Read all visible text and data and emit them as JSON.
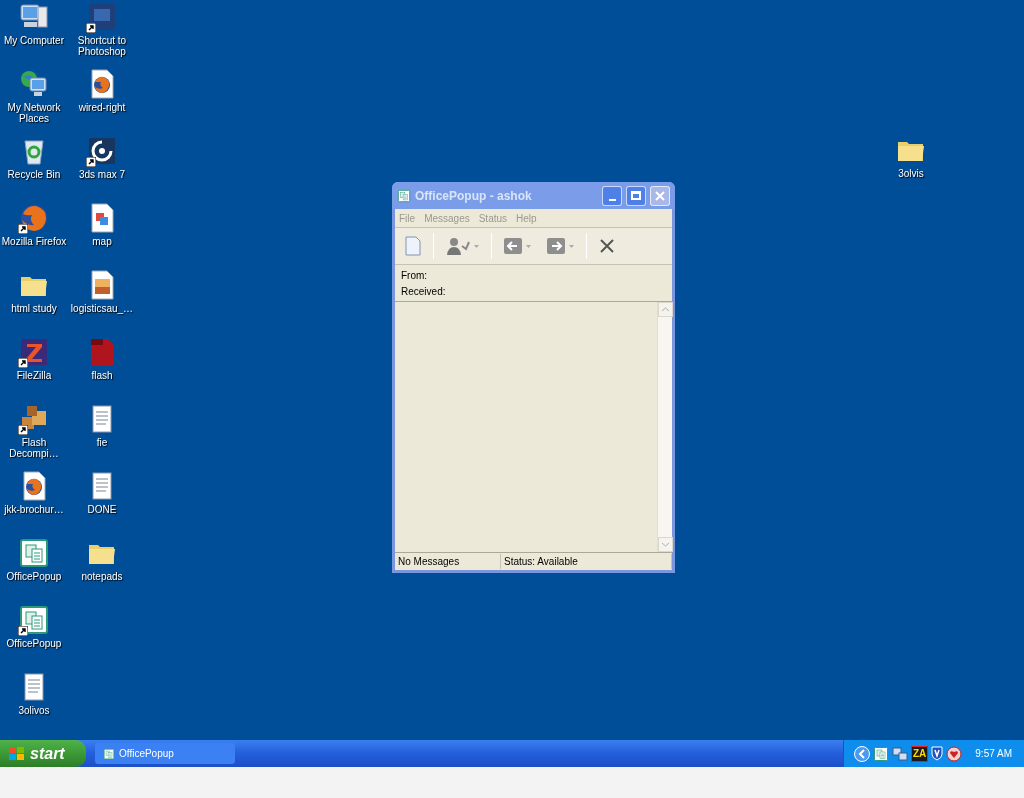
{
  "desktop": {
    "icons": [
      {
        "label": "My Computer",
        "kind": "computer",
        "shortcut": false
      },
      {
        "label": "My Network Places",
        "kind": "network",
        "shortcut": false
      },
      {
        "label": "Recycle Bin",
        "kind": "recycle",
        "shortcut": false
      },
      {
        "label": "Mozilla Firefox",
        "kind": "firefox",
        "shortcut": true
      },
      {
        "label": "html study",
        "kind": "folder",
        "shortcut": false
      },
      {
        "label": "FileZilla",
        "kind": "filezilla",
        "shortcut": true
      },
      {
        "label": "Flash Decompi…",
        "kind": "boxes",
        "shortcut": true
      },
      {
        "label": "jkk-brochur…",
        "kind": "firefox-doc",
        "shortcut": false
      },
      {
        "label": "OfficePopup",
        "kind": "officepopup",
        "shortcut": false
      },
      {
        "label": "OfficePopup",
        "kind": "officepopup",
        "shortcut": true
      },
      {
        "label": "3olivos",
        "kind": "text-doc",
        "shortcut": false
      },
      {
        "label": "Shortcut to Photoshop",
        "kind": "photoshop",
        "shortcut": true
      },
      {
        "label": "wired-right",
        "kind": "firefox-doc",
        "shortcut": false
      },
      {
        "label": "3ds max 7",
        "kind": "max",
        "shortcut": true
      },
      {
        "label": "map",
        "kind": "image-doc",
        "shortcut": false
      },
      {
        "label": "logisticsau_…",
        "kind": "photo-doc",
        "shortcut": false
      },
      {
        "label": "flash",
        "kind": "fla",
        "shortcut": false
      },
      {
        "label": "fie",
        "kind": "text-doc",
        "shortcut": false
      },
      {
        "label": "DONE",
        "kind": "text-doc",
        "shortcut": false
      },
      {
        "label": "notepads",
        "kind": "folder",
        "shortcut": false
      }
    ],
    "far_icon": {
      "label": "3olvis",
      "kind": "folder",
      "shortcut": false
    }
  },
  "window": {
    "title": "OfficePopup - ashok",
    "active": false,
    "menu": [
      "File",
      "Messages",
      "Status",
      "Help"
    ],
    "toolbar": [
      {
        "kind": "new",
        "dropdown": false
      },
      {
        "kind": "sep"
      },
      {
        "kind": "reply",
        "dropdown": true
      },
      {
        "kind": "sep"
      },
      {
        "kind": "back",
        "dropdown": true
      },
      {
        "kind": "forward",
        "dropdown": true
      },
      {
        "kind": "sep"
      },
      {
        "kind": "delete",
        "dropdown": false
      }
    ],
    "fields": [
      "From:",
      "Received:"
    ],
    "status_bar": [
      "No Messages",
      "Status: Available"
    ]
  },
  "taskbar": {
    "start": "start",
    "tasks": [
      {
        "label": "OfficePopup",
        "selected": false
      }
    ],
    "tray": [
      {
        "kind": "chevron"
      },
      {
        "kind": "officepopup"
      },
      {
        "kind": "network"
      },
      {
        "kind": "za",
        "text": "ZA"
      },
      {
        "kind": "shield"
      },
      {
        "kind": "messenger"
      }
    ],
    "clock": "9:57 AM"
  }
}
